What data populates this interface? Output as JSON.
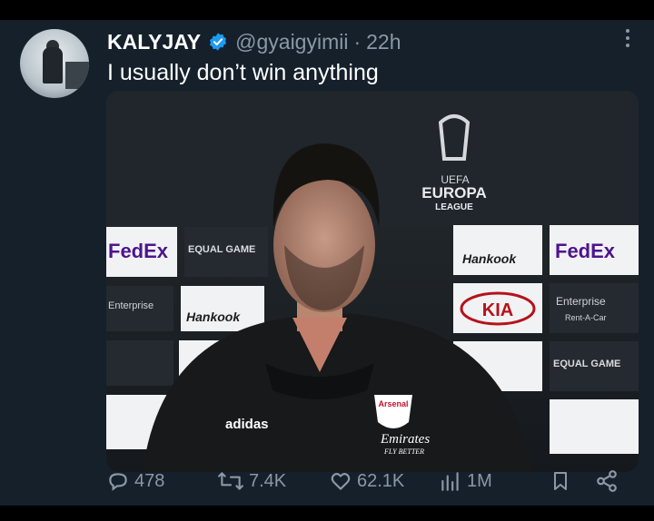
{
  "tweet": {
    "author_name": "KALYJAY",
    "handle": "@gyaigyimii",
    "separator": "·",
    "time": "22h",
    "text": "I usually don’t win anything"
  },
  "media": {
    "backdrop_sponsors": [
      "FedEx",
      "EQUAL GAME",
      "Enterprise",
      "Hankook",
      "KIA",
      "Rent-A-Car"
    ],
    "logo_text": [
      "UEFA",
      "EUROPA",
      "LEAGUE"
    ],
    "jacket_text": [
      "adidas",
      "Arsenal",
      "Emirates",
      "FLY BETTER"
    ]
  },
  "actions": {
    "replies": "478",
    "reposts": "7.4K",
    "likes": "62.1K",
    "views": "1M"
  },
  "colors": {
    "background": "#15202b",
    "text": "#ffffff",
    "muted": "#8b98a5",
    "verified": "#1d9bf0"
  }
}
